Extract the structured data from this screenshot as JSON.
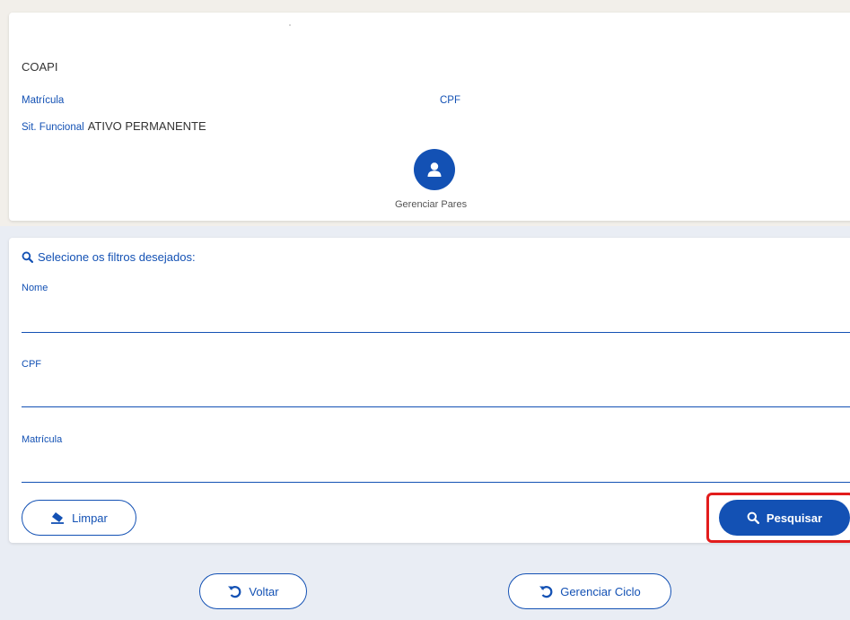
{
  "servidor": {
    "unit": "COAPI",
    "matricula_label": "Matrícula",
    "cpf_label": "CPF",
    "sit_label": "Sit. Funcional",
    "sit_value": "ATIVO PERMANENTE"
  },
  "pares": {
    "icon": "user-icon",
    "label": "Gerenciar Pares"
  },
  "filters": {
    "title": "Selecione os filtros desejados:",
    "fields": [
      {
        "label": "Nome",
        "value": ""
      },
      {
        "label": "CPF",
        "value": ""
      },
      {
        "label": "Matrícula",
        "value": ""
      }
    ],
    "clear_label": "Limpar",
    "search_label": "Pesquisar"
  },
  "footer": {
    "back_label": "Voltar",
    "cycle_label": "Gerenciar Ciclo"
  },
  "colors": {
    "primary": "#1351b4",
    "highlight": "#e21c1c",
    "background": "#e9edf4"
  }
}
